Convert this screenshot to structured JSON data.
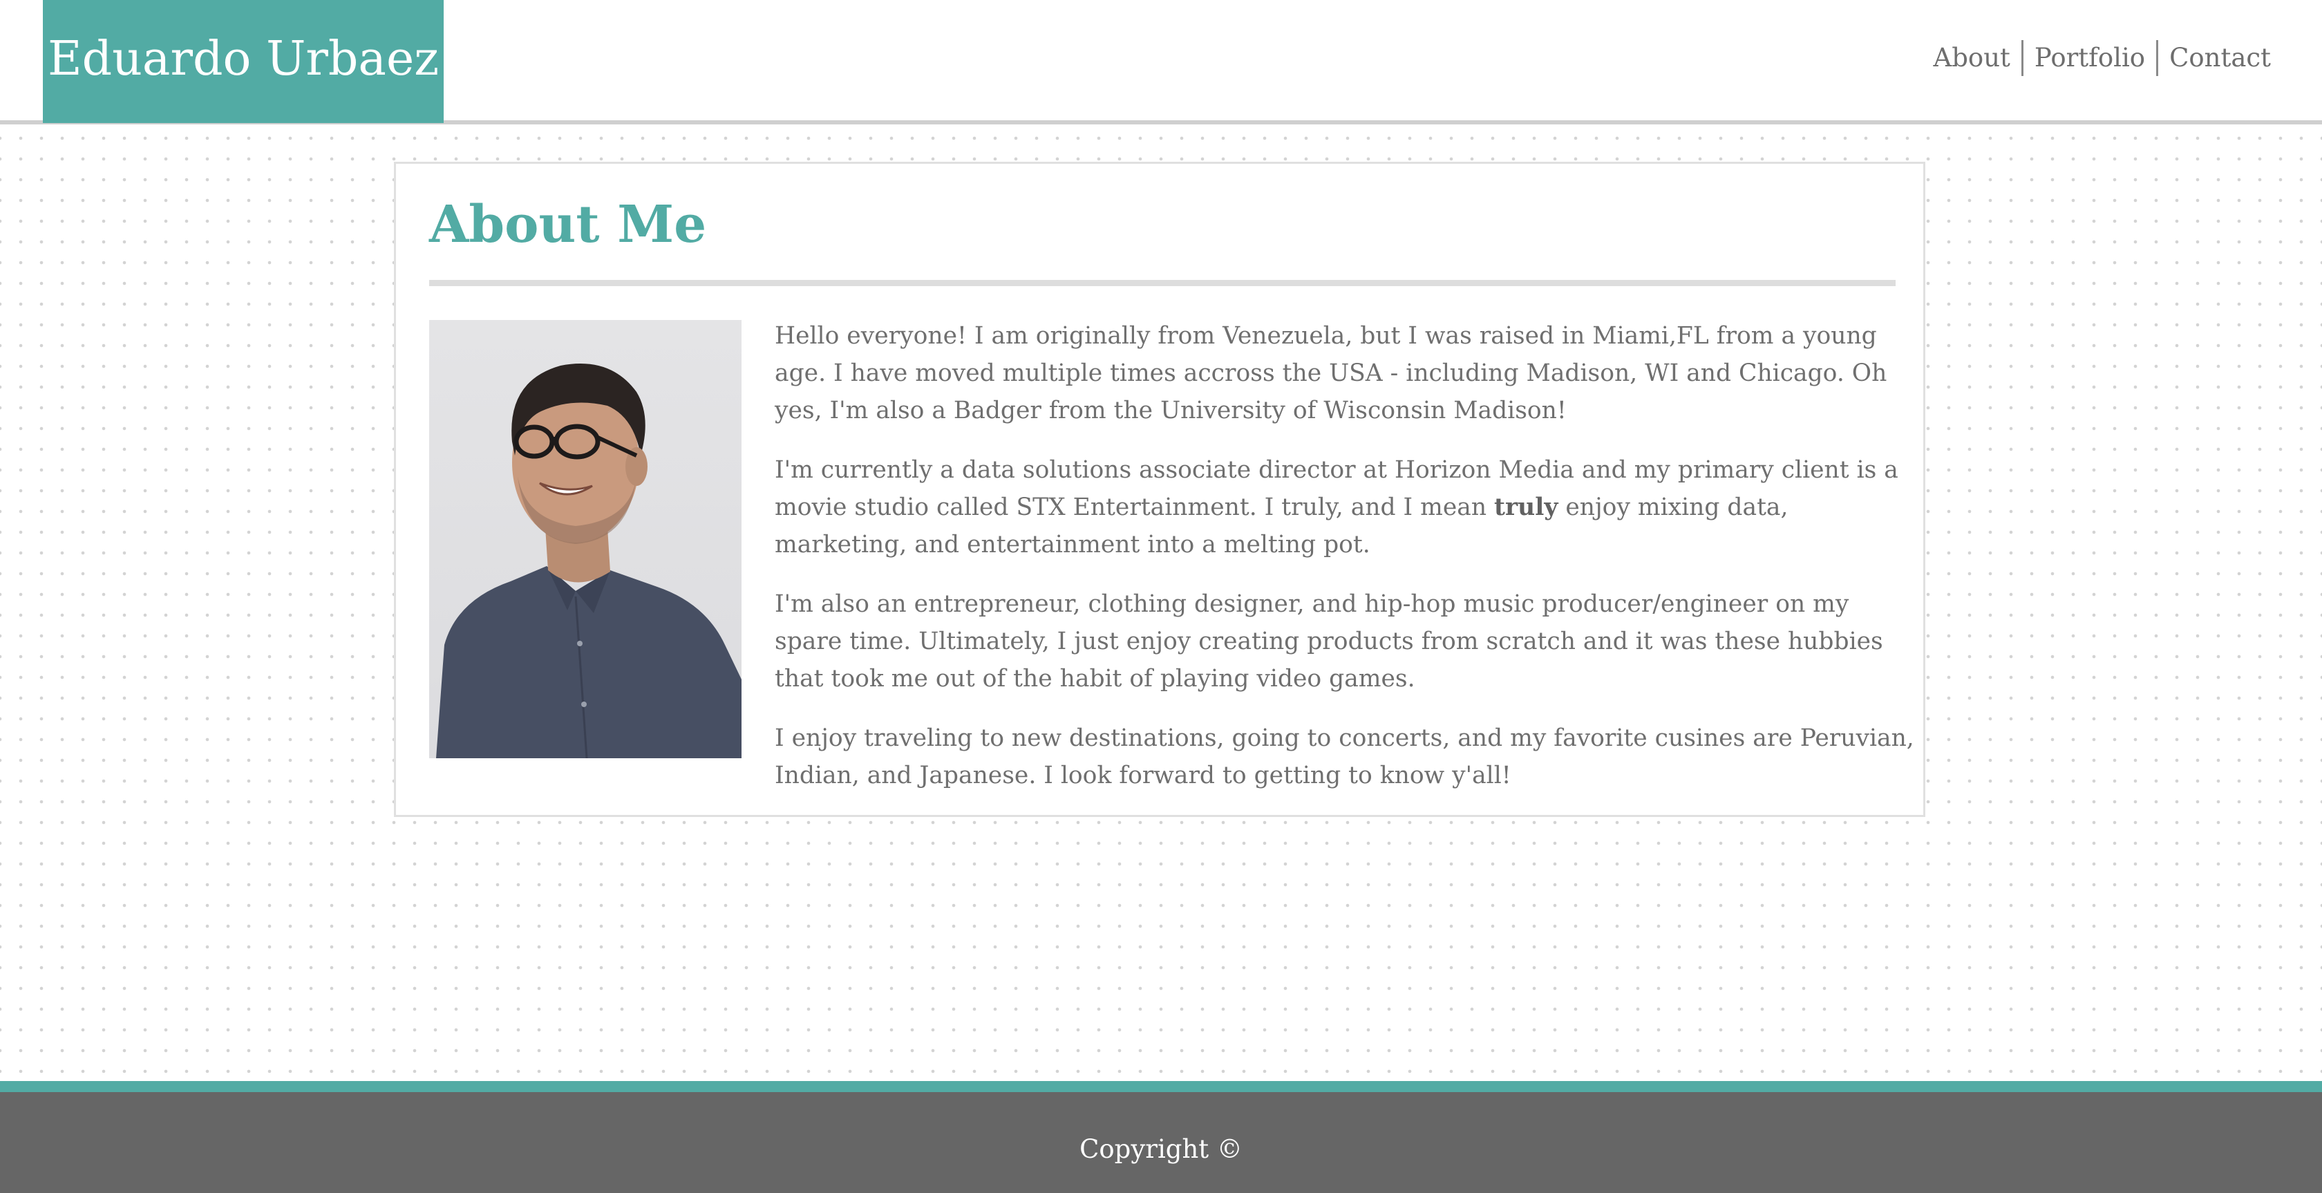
{
  "header": {
    "brand": "Eduardo Urbaez",
    "nav": [
      {
        "label": "About"
      },
      {
        "label": "Portfolio"
      },
      {
        "label": "Contact"
      }
    ]
  },
  "about": {
    "title": "About Me",
    "paragraphs": [
      {
        "text": "Hello everyone! I am originally from Venezuela, but I was raised in Miami,FL from a young age. I have moved multiple times accross the USA - including Madison, WI and Chicago. Oh yes, I'm also a Badger from the University of Wisconsin Madison!"
      },
      {
        "before": "I'm currently a data solutions associate director at Horizon Media and my primary client is a movie studio called STX Entertainment. I truly, and I mean ",
        "bold": "truly",
        "after": " enjoy mixing data, marketing, and entertainment into a melting pot."
      },
      {
        "text": "I'm also an entrepreneur, clothing designer, and hip-hop music producer/engineer on my spare time. Ultimately, I just enjoy creating products from scratch and it was these hubbies that took me out of the habit of playing video games."
      },
      {
        "text": "I enjoy traveling to new destinations, going to concerts, and my favorite cusines are Peruvian, Indian, and Japanese. I look forward to getting to know y'all!"
      }
    ]
  },
  "footer": {
    "copyright": "Copyright ©"
  },
  "colors": {
    "accent": "#52aba4",
    "footer_bg": "#666666",
    "body_text": "#6f6f6f"
  }
}
